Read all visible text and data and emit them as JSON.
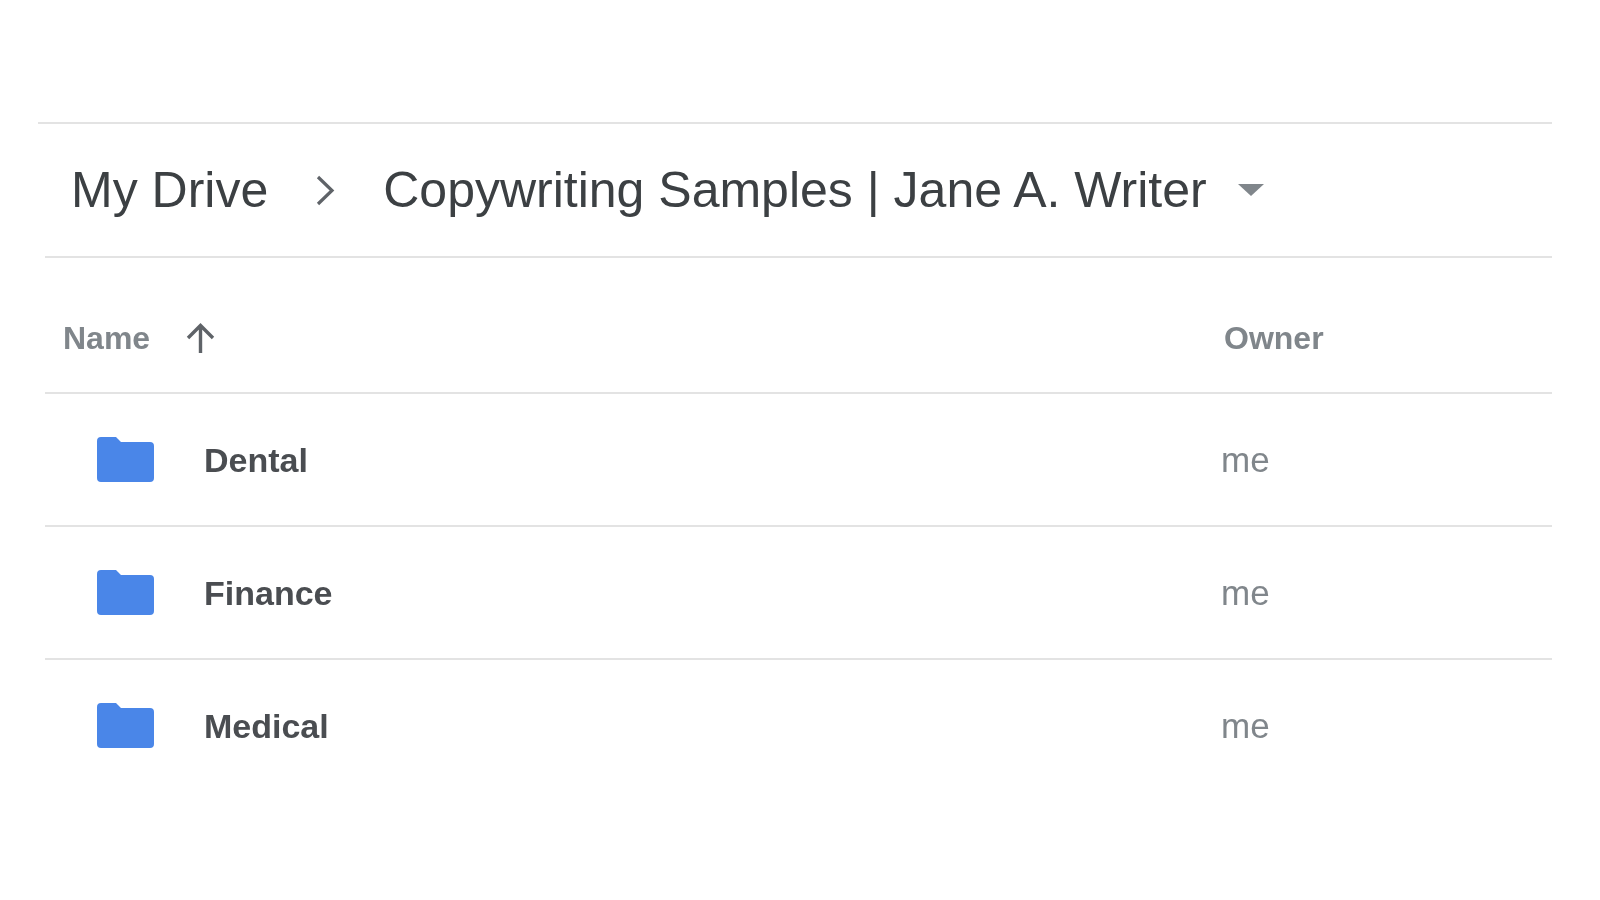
{
  "breadcrumb": {
    "items": [
      {
        "label": "My Drive",
        "menu": false
      },
      {
        "label": "Copywriting Samples | Jane A. Writer",
        "menu": true
      }
    ]
  },
  "table": {
    "columns": [
      {
        "label": "Name",
        "sorted": true
      },
      {
        "label": "Owner",
        "sorted": false
      }
    ],
    "rows": [
      {
        "name": "Dental",
        "owner": "me"
      },
      {
        "name": "Finance",
        "owner": "me"
      },
      {
        "name": "Medical",
        "owner": "me"
      }
    ]
  }
}
